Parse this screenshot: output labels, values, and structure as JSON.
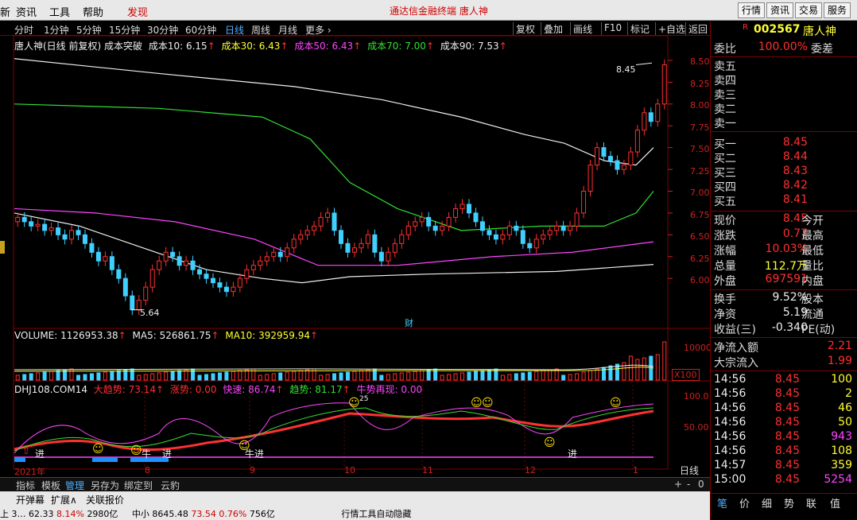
{
  "menubar": {
    "left_items": [
      "新",
      "资讯",
      "工具",
      "帮助",
      "发现"
    ],
    "app_title": "通达信金融终端    唐人神",
    "right_buttons": [
      "行情",
      "资讯",
      "交易",
      "服务"
    ]
  },
  "periodbar": {
    "periods": [
      "分时",
      "1分钟",
      "5分钟",
      "15分钟",
      "30分钟",
      "60分钟",
      "日线",
      "周线",
      "月线",
      "更多 ›"
    ],
    "active": "日线",
    "tools": [
      "复权",
      "叠加",
      "画线",
      "F10",
      "标记",
      "+自选",
      "返回"
    ]
  },
  "main_legend": {
    "prefix": "唐人神(日线 前复权) 成本突破",
    "items": [
      {
        "label": "成本10: 6.15",
        "color": "#eeeeee"
      },
      {
        "label": "成本30: 6.43",
        "color": "#ffff33"
      },
      {
        "label": "成本50: 6.43",
        "color": "#ff44ff"
      },
      {
        "label": "成本70: 7.00",
        "color": "#30e030"
      },
      {
        "label": "成本90: 7.53",
        "color": "#eeeeee"
      }
    ]
  },
  "volume_legend": {
    "items": [
      {
        "label": "VOLUME: 1126953.38",
        "color": "#eeeeee"
      },
      {
        "label": "MA5: 526861.75",
        "color": "#eeeeee"
      },
      {
        "label": "MA10: 392959.94",
        "color": "#ffff33"
      }
    ],
    "y_tick": "10000",
    "unit_box": "X100"
  },
  "indicator_legend": {
    "items": [
      {
        "label": "DHJ108.COM14",
        "color": "#eeeeee"
      },
      {
        "label": "大趋势: 73.14",
        "color": "#ff3030"
      },
      {
        "label": "涨势: 0.00",
        "color": "#ff3030"
      },
      {
        "label": "快速: 86.74",
        "color": "#ff44ff"
      },
      {
        "label": "趋势: 81.17",
        "color": "#30e030"
      },
      {
        "label": "牛势再现: 0.00",
        "color": "#ff44ff"
      }
    ],
    "y_ticks": [
      "100.0",
      "50.00"
    ],
    "markers": [
      "进",
      "牛",
      "牛进",
      "进",
      "进",
      "25"
    ],
    "mark_x_labels": [
      "8",
      "9",
      "10",
      "11",
      "12",
      "1"
    ]
  },
  "price_axis": [
    "8.50",
    "8.25",
    "8.00",
    "7.75",
    "7.50",
    "7.25",
    "7.00",
    "6.75",
    "6.50",
    "6.25",
    "6.00"
  ],
  "annotations": {
    "high": "8.45",
    "low": "5.64",
    "cai": "财"
  },
  "x_axis": {
    "labels": [
      "2021年",
      "8",
      "9",
      "10",
      "11",
      "12",
      "1"
    ],
    "period_label": "日线"
  },
  "bottom_tabs": [
    "指标",
    "模板",
    "管理",
    "另存为",
    "绑定到",
    "云豹"
  ],
  "bottom_active": "管理",
  "statusbar": {
    "items": [
      "开弹幕",
      "扩展∧",
      "关联报价"
    ],
    "line2": [
      "上 3… 62.33",
      "8.14%",
      "2980亿",
      "中小 8645.48",
      "73.54",
      "0.76%",
      "756亿",
      "行情工具自动隐藏"
    ]
  },
  "right": {
    "code": "002567",
    "name": "唐人神",
    "weibi_label": "委比",
    "weibi_value": "100.00%",
    "weicha_label": "委差",
    "asks": [
      "卖五",
      "卖四",
      "卖三",
      "卖二",
      "卖一"
    ],
    "bids": [
      {
        "label": "买一",
        "price": "8.45",
        "vol": "",
        "color": "#ff3030"
      },
      {
        "label": "买二",
        "price": "8.44",
        "vol": "",
        "color": "#ff3030"
      },
      {
        "label": "买三",
        "price": "8.43",
        "vol": "",
        "color": "#ff3030"
      },
      {
        "label": "买四",
        "price": "8.42",
        "vol": "",
        "color": "#ff3030"
      },
      {
        "label": "买五",
        "price": "8.41",
        "vol": "",
        "color": "#ff3030"
      }
    ],
    "quote": [
      {
        "l1": "现价",
        "v1": "8.45",
        "c1": "#ff3030",
        "l2": "今开"
      },
      {
        "l1": "涨跌",
        "v1": "0.77",
        "c1": "#ff3030",
        "l2": "最高"
      },
      {
        "l1": "涨幅",
        "v1": "10.03%",
        "c1": "#ff3030",
        "l2": "最低"
      },
      {
        "l1": "总量",
        "v1": "112.7万",
        "c1": "#ffff33",
        "l2": "量比"
      },
      {
        "l1": "外盘",
        "v1": "697591",
        "c1": "#ff3030",
        "l2": "内盘"
      }
    ],
    "fin": [
      {
        "l1": "换手",
        "v1": "9.52%",
        "l2": "股本"
      },
      {
        "l1": "净资",
        "v1": "5.19",
        "l2": "流通"
      },
      {
        "l1": "收益(三)",
        "v1": "-0.340",
        "l2": "PE(动)"
      }
    ],
    "flow": [
      {
        "label": "净流入额",
        "value": "2.21"
      },
      {
        "label": "大宗流入",
        "value": "1.99"
      }
    ],
    "ticks": [
      {
        "time": "14:56",
        "price": "8.45",
        "vol": "100",
        "vc": "#ffff33"
      },
      {
        "time": "14:56",
        "price": "8.45",
        "vol": "2",
        "vc": "#ffff33"
      },
      {
        "time": "14:56",
        "price": "8.45",
        "vol": "46",
        "vc": "#ffff33"
      },
      {
        "time": "14:56",
        "price": "8.45",
        "vol": "50",
        "vc": "#ffff33"
      },
      {
        "time": "14:56",
        "price": "8.45",
        "vol": "943",
        "vc": "#ff44ff"
      },
      {
        "time": "14:56",
        "price": "8.45",
        "vol": "108",
        "vc": "#ffff33"
      },
      {
        "time": "14:57",
        "price": "8.45",
        "vol": "359",
        "vc": "#ffff33"
      },
      {
        "time": "15:00",
        "price": "8.45",
        "vol": "5254",
        "vc": "#ff44ff"
      }
    ],
    "bottom_tabs": [
      "笔",
      "价",
      "细",
      "势",
      "联",
      "值"
    ]
  },
  "colors": {
    "up": "#ff3030",
    "down": "#40d0ff",
    "grid": "#800000",
    "ma_white": "#eeeeee",
    "ma_green": "#30e030",
    "ma_magenta": "#ff44ff",
    "ma_yellow": "#ffff33"
  },
  "chart_data": {
    "type": "candlestick",
    "price_range": [
      5.5,
      8.6
    ],
    "closes": [
      6.7,
      6.65,
      6.6,
      6.62,
      6.55,
      6.58,
      6.5,
      6.45,
      6.55,
      6.5,
      6.4,
      6.3,
      6.2,
      6.25,
      6.1,
      6.0,
      5.8,
      5.64,
      5.75,
      5.9,
      6.1,
      6.2,
      6.3,
      6.25,
      6.15,
      6.2,
      6.1,
      6.05,
      6.0,
      5.95,
      5.9,
      5.85,
      5.9,
      6.0,
      6.1,
      6.15,
      6.2,
      6.25,
      6.3,
      6.25,
      6.35,
      6.45,
      6.5,
      6.55,
      6.6,
      6.7,
      6.75,
      6.55,
      6.4,
      6.3,
      6.35,
      6.4,
      6.5,
      6.3,
      6.2,
      6.3,
      6.4,
      6.5,
      6.6,
      6.65,
      6.7,
      6.6,
      6.55,
      6.6,
      6.7,
      6.8,
      6.85,
      6.75,
      6.65,
      6.55,
      6.5,
      6.45,
      6.5,
      6.6,
      6.55,
      6.4,
      6.35,
      6.45,
      6.5,
      6.55,
      6.6,
      6.55,
      6.6,
      6.75,
      7.0,
      7.3,
      7.5,
      7.4,
      7.35,
      7.25,
      7.3,
      7.45,
      7.7,
      7.9,
      7.8,
      8.0,
      8.45
    ]
  }
}
